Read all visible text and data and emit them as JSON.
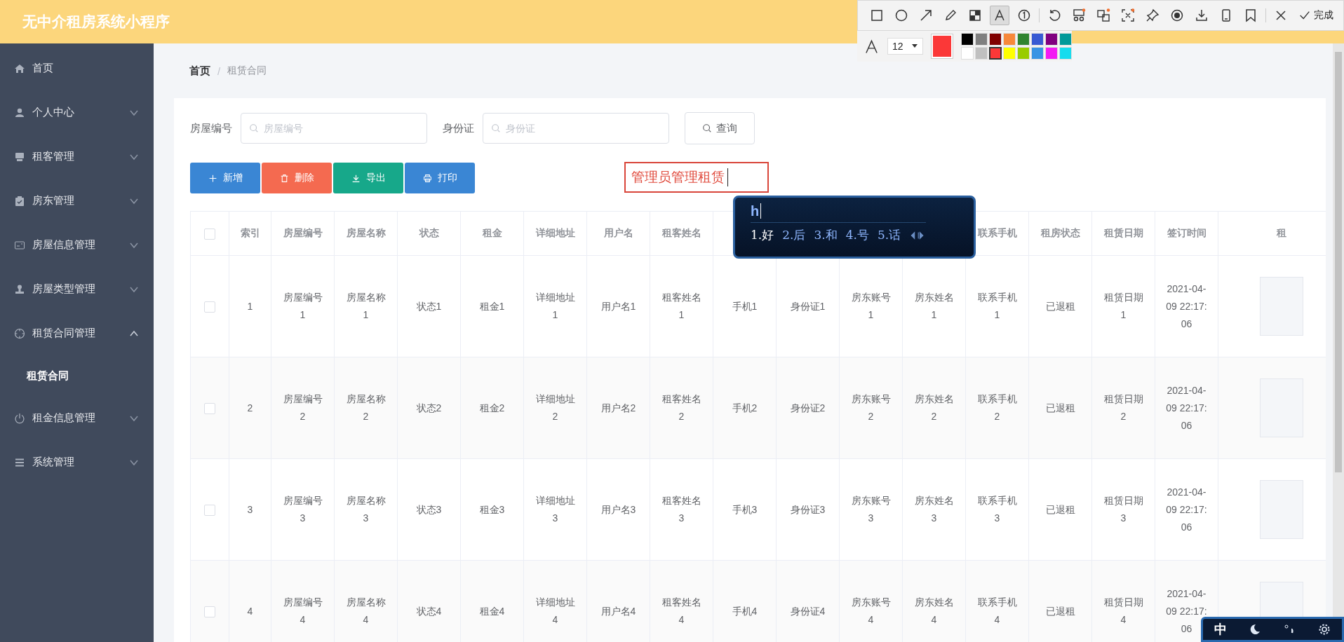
{
  "header": {
    "title": "无中介租房系统小程序"
  },
  "sidebar": {
    "items": [
      {
        "label": "首页",
        "kind": "home"
      },
      {
        "label": "个人中心",
        "kind": "user",
        "expanded": false
      },
      {
        "label": "租客管理",
        "kind": "printer",
        "expanded": false
      },
      {
        "label": "房东管理",
        "kind": "clipboard",
        "expanded": false
      },
      {
        "label": "房屋信息管理",
        "kind": "card",
        "expanded": false
      },
      {
        "label": "房屋类型管理",
        "kind": "stamp",
        "expanded": false
      },
      {
        "label": "租赁合同管理",
        "kind": "target",
        "expanded": true,
        "children": [
          {
            "label": "租赁合同",
            "selected": true
          }
        ]
      },
      {
        "label": "租金信息管理",
        "kind": "power",
        "expanded": false
      },
      {
        "label": "系统管理",
        "kind": "menu",
        "expanded": false
      }
    ]
  },
  "breadcrumb": [
    "首页",
    "租赁合同"
  ],
  "breadcrumb_separator": "/",
  "search": {
    "fields": [
      {
        "label": "房屋编号",
        "placeholder": "房屋编号"
      },
      {
        "label": "身份证",
        "placeholder": "身份证"
      }
    ],
    "button": "查询"
  },
  "actions": [
    {
      "label": "新增",
      "kind": "plus",
      "color": "#3a86d4"
    },
    {
      "label": "删除",
      "kind": "trash",
      "color": "#f46a50"
    },
    {
      "label": "导出",
      "kind": "download",
      "color": "#17a88a"
    },
    {
      "label": "打印",
      "kind": "print",
      "color": "#3a86d4"
    }
  ],
  "table": {
    "all_checked": false,
    "columns": [
      "索引",
      "房屋编号",
      "房屋名称",
      "状态",
      "租金",
      "详细地址",
      "用户名",
      "租客姓名",
      null,
      null,
      null,
      null,
      "联系手机",
      "租房状态",
      "租赁日期",
      "签订时间",
      "租"
    ],
    "rows": [
      {
        "checked": false,
        "cells": [
          "1",
          "房屋编号1",
          "房屋名称1",
          "状态1",
          "租金1",
          "详细地址1",
          "用户名1",
          "租客姓名1",
          "手机1",
          "身份证1",
          "房东账号1",
          "房东姓名1",
          "联系手机1",
          "已退租",
          "租赁日期1",
          "2021-04-09 22:17:06"
        ]
      },
      {
        "checked": false,
        "cells": [
          "2",
          "房屋编号2",
          "房屋名称2",
          "状态2",
          "租金2",
          "详细地址2",
          "用户名2",
          "租客姓名2",
          "手机2",
          "身份证2",
          "房东账号2",
          "房东姓名2",
          "联系手机2",
          "已退租",
          "租赁日期2",
          "2021-04-09 22:17:06"
        ]
      },
      {
        "checked": false,
        "cells": [
          "3",
          "房屋编号3",
          "房屋名称3",
          "状态3",
          "租金3",
          "详细地址3",
          "用户名3",
          "租客姓名3",
          "手机3",
          "身份证3",
          "房东账号3",
          "房东姓名3",
          "联系手机3",
          "已退租",
          "租赁日期3",
          "2021-04-09 22:17:06"
        ]
      },
      {
        "checked": false,
        "cells": [
          "4",
          "房屋编号4",
          "房屋名称4",
          "状态4",
          "租金4",
          "详细地址4",
          "用户名4",
          "租客姓名4",
          "手机4",
          "身份证4",
          "房东账号4",
          "房东姓名4",
          "联系手机4",
          "已退租",
          "租赁日期4",
          "2021-04-09 22:17:06"
        ]
      }
    ]
  },
  "annotation": {
    "text": "管理员管理租赁"
  },
  "ime": {
    "input": "h",
    "candidates": [
      "1.好",
      "2.后",
      "3.和",
      "4.号",
      "5.话"
    ],
    "status": "中"
  },
  "capture_toolbar": {
    "tools": [
      {
        "kind": "rectangle",
        "selected": false
      },
      {
        "kind": "ellipse",
        "selected": false
      },
      {
        "kind": "arrow",
        "selected": false
      },
      {
        "kind": "pencil",
        "selected": false
      },
      {
        "kind": "mosaic",
        "selected": false
      },
      {
        "kind": "text",
        "selected": true
      },
      {
        "kind": "number",
        "selected": false
      },
      {
        "kind": "undo",
        "selected": false
      },
      {
        "kind": "scissors",
        "selected": false
      },
      {
        "kind": "translate",
        "selected": false
      },
      {
        "kind": "ocr",
        "selected": false
      },
      {
        "kind": "pin",
        "selected": false
      },
      {
        "kind": "record",
        "selected": false
      },
      {
        "kind": "save",
        "selected": false
      },
      {
        "kind": "phone",
        "selected": false
      },
      {
        "kind": "bookmark",
        "selected": false
      }
    ],
    "done": "完成",
    "font_size": "12",
    "palette": [
      {
        "color": "#000000",
        "selected": false
      },
      {
        "color": "#808080",
        "selected": false
      },
      {
        "color": "#800000",
        "selected": false
      },
      {
        "color": "#f7883a",
        "selected": false
      },
      {
        "color": "#308430",
        "selected": false
      },
      {
        "color": "#385ad3",
        "selected": false
      },
      {
        "color": "#800080",
        "selected": false
      },
      {
        "color": "#009999",
        "selected": false
      },
      {
        "color": "#ffffff",
        "selected": false
      },
      {
        "color": "#c0c0c0",
        "selected": false
      },
      {
        "color": "#fb3838",
        "selected": true
      },
      {
        "color": "#ffff00",
        "selected": false
      },
      {
        "color": "#99cc00",
        "selected": false
      },
      {
        "color": "#3894e4",
        "selected": false
      },
      {
        "color": "#f31bf3",
        "selected": false
      },
      {
        "color": "#16dcee",
        "selected": false
      }
    ]
  }
}
